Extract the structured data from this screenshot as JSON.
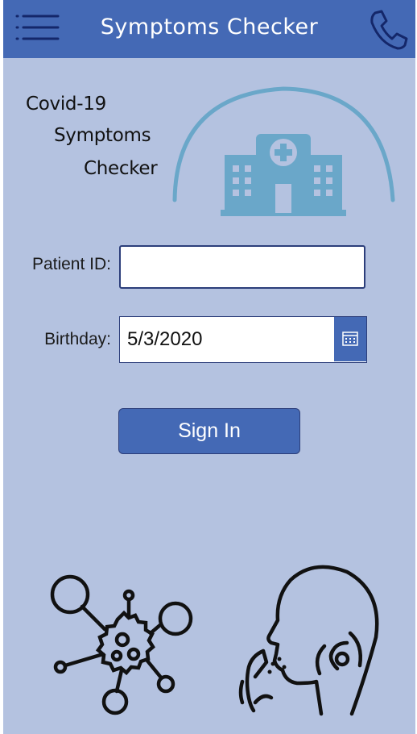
{
  "header": {
    "title": "Symptoms Checker",
    "menu_icon": "hamburger-menu-icon",
    "call_icon": "phone-icon"
  },
  "headline": {
    "line1": "Covid-19",
    "line2": "Symptoms",
    "line3": "Checker"
  },
  "form": {
    "patient_id_label": "Patient ID:",
    "patient_id_value": "",
    "birthday_label": "Birthday:",
    "birthday_value": "5/3/2020",
    "calendar_icon": "calendar-icon"
  },
  "signin": {
    "label": "Sign In"
  },
  "illustrations": [
    "hospital-icon",
    "virus-icon",
    "cough-icon"
  ],
  "colors": {
    "brand": "#4469b5",
    "background": "#b4c2e0",
    "hospital": "#6aa7c9",
    "border": "#2c3e7a"
  }
}
